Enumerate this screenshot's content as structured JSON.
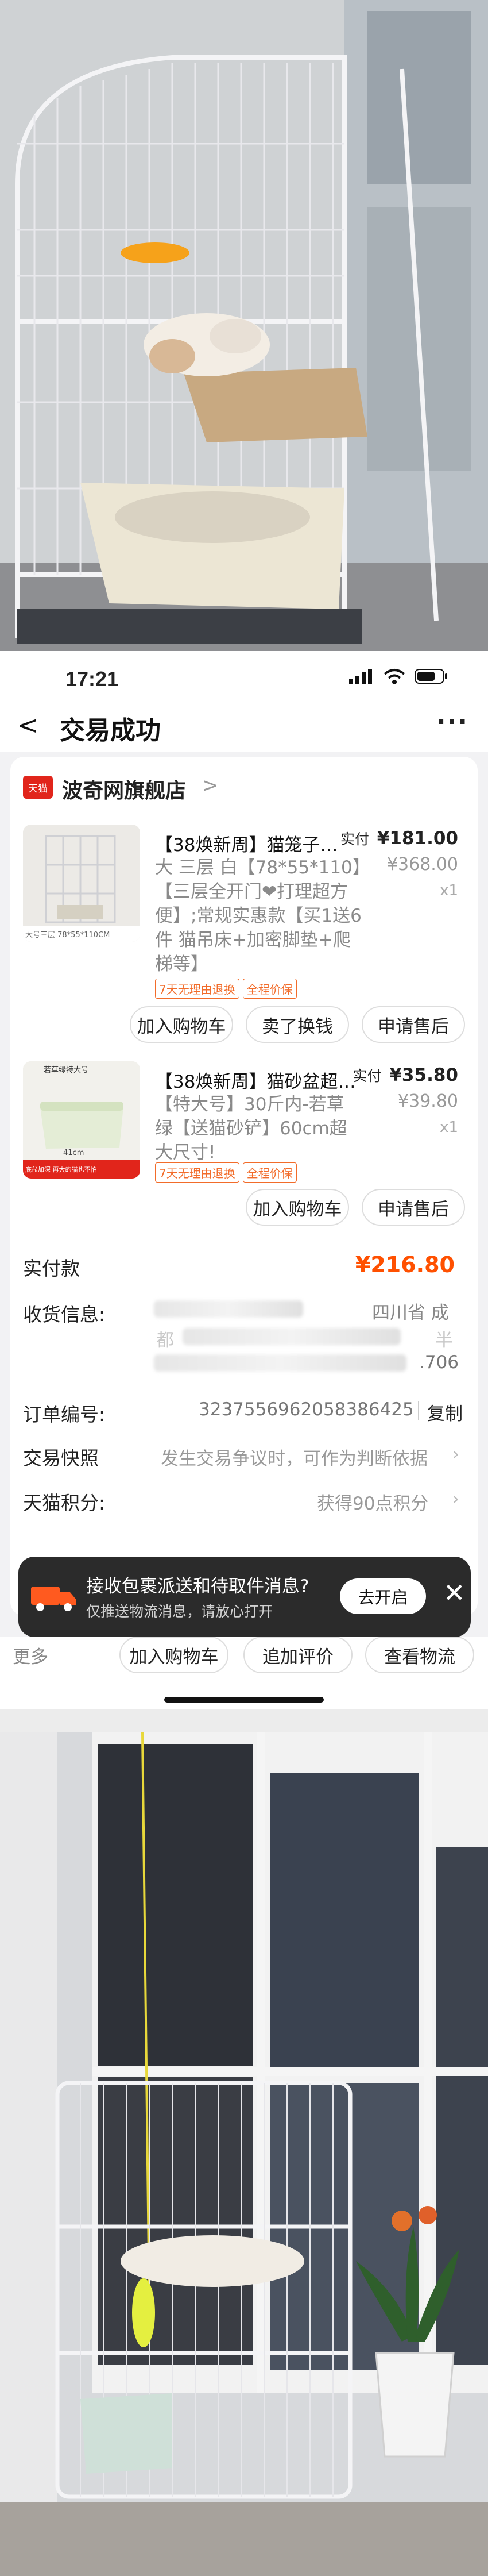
{
  "status": {
    "time": "17:21"
  },
  "nav": {
    "back": "<",
    "title": "交易成功",
    "more": "···"
  },
  "store": {
    "badge": "天猫",
    "name": "波奇网旗舰店",
    "chevron": ">"
  },
  "products": [
    {
      "title": "【38焕新周】猫笼子…",
      "desc": "大 三层 白【78*55*110】【三层全开门❤打理超方便】;常规实惠款【买1送6件 猫吊床+加密脚垫+爬梯等】",
      "paid_label": "实付",
      "paid": "¥181.00",
      "orig": "¥368.00",
      "qty": "x1",
      "thumb_caption": "大号三层 78*55*110CM",
      "tags": [
        "7天无理由退换",
        "全程价保"
      ],
      "buttons": [
        "加入购物车",
        "卖了换钱",
        "申请售后"
      ]
    },
    {
      "title": "【38焕新周】猫砂盆超…",
      "desc": "【特大号】30斤内-若草绿【送猫砂铲】60cm超大尺寸!",
      "paid_label": "实付",
      "paid": "¥35.80",
      "orig": "¥39.80",
      "qty": "x1",
      "thumb_caption": "若草绿特大号",
      "thumb_size": "41cm",
      "thumb_bottom": "底盆加深 再大的猫也不怕",
      "tags": [
        "7天无理由退换",
        "全程价保"
      ],
      "buttons": [
        "加入购物车",
        "申请售后"
      ]
    }
  ],
  "summary": {
    "paid_label": "实付款",
    "paid_value": "¥216.80",
    "receiver_label": "收货信息:",
    "receiver_visible": [
      "四川省 成",
      "都",
      "半",
      ".706"
    ],
    "order_label": "订单编号:",
    "order_value": "3237556962058386425",
    "copy": "复制",
    "snapshot_label": "交易快照",
    "snapshot_value": "发生交易争议时，可作为判断依据",
    "points_label": "天猫积分:",
    "points_value": "获得90点积分"
  },
  "toast": {
    "title": "接收包裹派送和待取件消息?",
    "subtitle": "仅推送物流消息，请放心打开",
    "button": "去开启",
    "close": "✕"
  },
  "bottom": {
    "more": "更多",
    "buttons": [
      "加入购物车",
      "追加评价",
      "查看物流"
    ]
  },
  "colors": {
    "accent": "#ff5000",
    "tmall": "#e1251b",
    "tag": "#f26c2a"
  }
}
